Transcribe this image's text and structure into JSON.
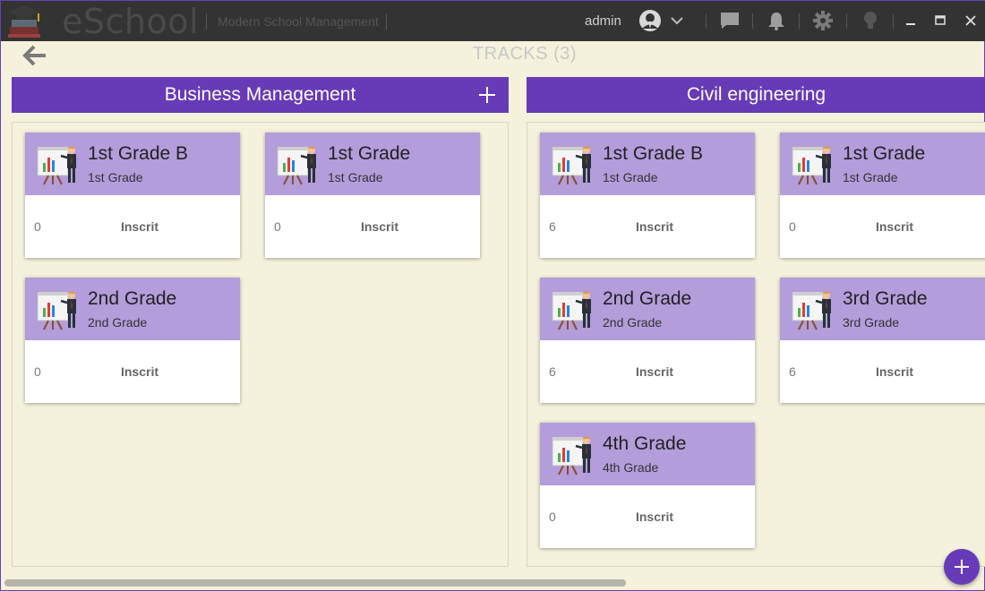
{
  "app": {
    "name": "eSchool",
    "tagline": "Modern School Management",
    "user": "admin"
  },
  "page": {
    "title": "TRACKS (3)"
  },
  "tracks": [
    {
      "name": "Business Management",
      "has_add": true,
      "cards": [
        {
          "title": "1st Grade B",
          "subtitle": "1st Grade",
          "count": "0",
          "label": "Inscrit"
        },
        {
          "title": "1st Grade",
          "subtitle": "1st Grade",
          "count": "0",
          "label": "Inscrit"
        },
        {
          "title": "2nd Grade",
          "subtitle": "2nd Grade",
          "count": "0",
          "label": "Inscrit"
        }
      ]
    },
    {
      "name": "Civil engineering",
      "has_add": false,
      "cards": [
        {
          "title": "1st Grade B",
          "subtitle": "1st Grade",
          "count": "6",
          "label": "Inscrit"
        },
        {
          "title": "1st Grade",
          "subtitle": "1st Grade",
          "count": "0",
          "label": "Inscrit"
        },
        {
          "title": "2nd Grade",
          "subtitle": "2nd Grade",
          "count": "6",
          "label": "Inscrit"
        },
        {
          "title": "3rd Grade",
          "subtitle": "3rd Grade",
          "count": "6",
          "label": "Inscrit"
        },
        {
          "title": "4th Grade",
          "subtitle": "4th Grade",
          "count": "0",
          "label": "Inscrit"
        }
      ]
    }
  ],
  "icons": {
    "logo": "school-books-icon",
    "avatar": "user-avatar-icon",
    "chat": "chat-icon",
    "notifications": "bell-icon",
    "settings": "gear-icon",
    "tips": "lightbulb-icon",
    "back": "arrow-left-icon",
    "add": "plus-icon",
    "card": "presentation-teacher-icon"
  },
  "colors": {
    "titlebar": "#333333",
    "accent": "#673ab7",
    "card_header": "#b39ddb",
    "background": "#f4f2dc"
  }
}
